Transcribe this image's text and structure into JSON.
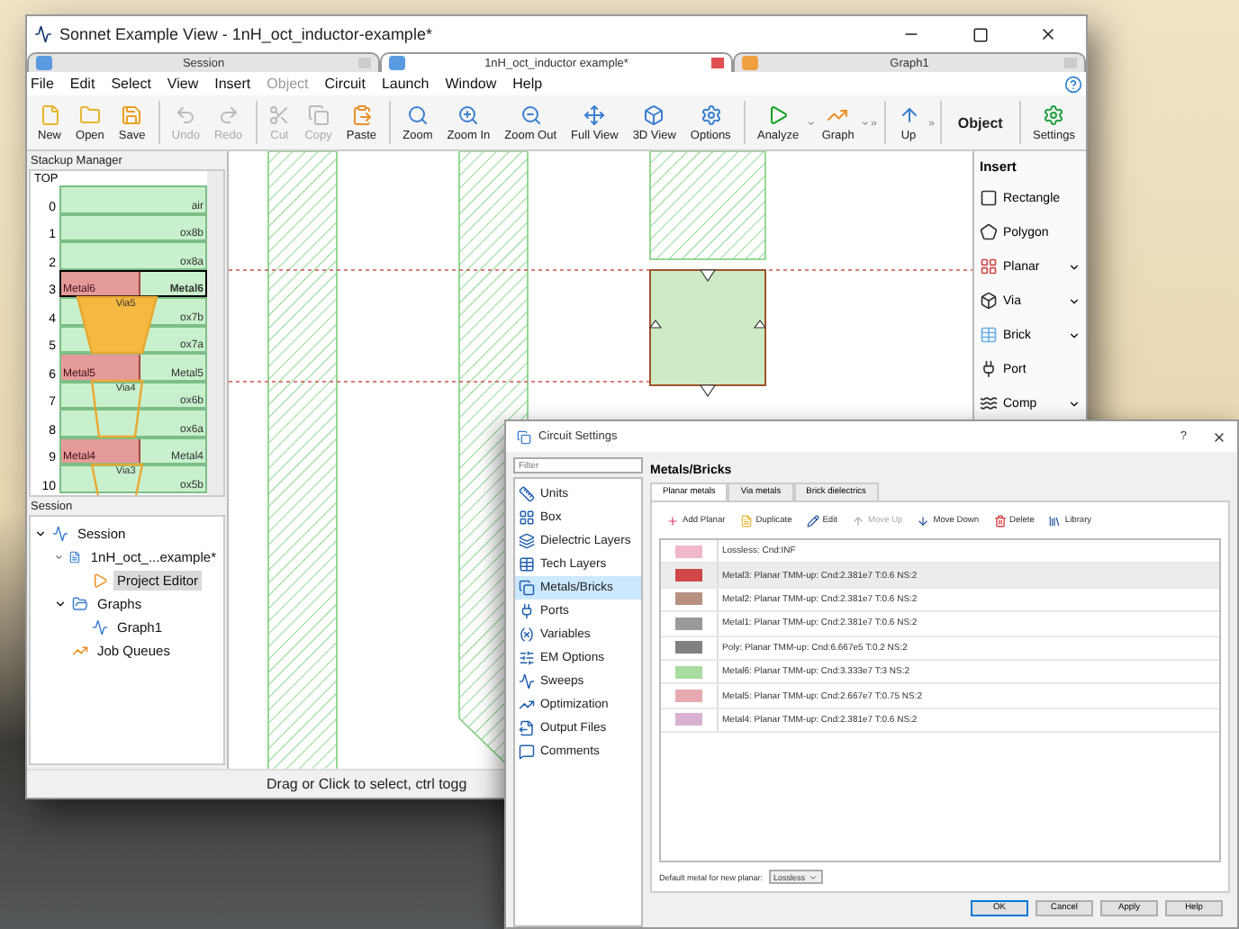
{
  "window": {
    "title": "Sonnet Example View - 1nH_oct_inductor-example*"
  },
  "tabs": [
    {
      "label": "Session",
      "selected": false
    },
    {
      "label": "1nH_oct_inductor example*",
      "selected": true
    },
    {
      "label": "Graph1",
      "selected": false
    }
  ],
  "menu": [
    {
      "label": "File",
      "disabled": false
    },
    {
      "label": "Edit",
      "disabled": false
    },
    {
      "label": "Select",
      "disabled": false
    },
    {
      "label": "View",
      "disabled": false
    },
    {
      "label": "Insert",
      "disabled": false
    },
    {
      "label": "Object",
      "disabled": true
    },
    {
      "label": "Circuit",
      "disabled": false
    },
    {
      "label": "Launch",
      "disabled": false
    },
    {
      "label": "Window",
      "disabled": false
    },
    {
      "label": "Help",
      "disabled": false
    }
  ],
  "toolbar": [
    {
      "kind": "button",
      "label": "New",
      "disabled": false
    },
    {
      "kind": "button",
      "label": "Open",
      "disabled": false
    },
    {
      "kind": "button",
      "label": "Save",
      "disabled": false
    },
    {
      "kind": "separator"
    },
    {
      "kind": "button",
      "label": "Undo",
      "disabled": true
    },
    {
      "kind": "button",
      "label": "Redo",
      "disabled": true
    },
    {
      "kind": "separator"
    },
    {
      "kind": "button",
      "label": "Cut",
      "disabled": true
    },
    {
      "kind": "button",
      "label": "Copy",
      "disabled": true
    },
    {
      "kind": "button",
      "label": "Paste",
      "disabled": false
    },
    {
      "kind": "separator"
    },
    {
      "kind": "button",
      "label": "Zoom",
      "disabled": false
    },
    {
      "kind": "button",
      "label": "Zoom In",
      "disabled": false
    },
    {
      "kind": "button",
      "label": "Zoom Out",
      "disabled": false
    },
    {
      "kind": "button",
      "label": "Full View",
      "disabled": false
    },
    {
      "kind": "button",
      "label": "3D View",
      "disabled": false
    },
    {
      "kind": "button",
      "label": "Options",
      "disabled": false
    },
    {
      "kind": "separator"
    },
    {
      "kind": "split",
      "label": "Analyze",
      "disabled": false
    },
    {
      "kind": "split",
      "label": "Graph",
      "disabled": false
    },
    {
      "kind": "overflow"
    },
    {
      "kind": "separator"
    },
    {
      "kind": "button",
      "label": "Up",
      "disabled": false
    },
    {
      "kind": "overflow"
    },
    {
      "kind": "separator"
    },
    {
      "kind": "text",
      "label": "Object",
      "disabled": false
    },
    {
      "kind": "separator"
    },
    {
      "kind": "button",
      "label": "Settings",
      "disabled": false
    }
  ],
  "stackup": {
    "title": "Stackup Manager",
    "top_label": "TOP",
    "rows": [
      {
        "index": "0",
        "layer": "air",
        "selected": false
      },
      {
        "index": "1",
        "layer": "ox8b",
        "selected": false
      },
      {
        "index": "2",
        "layer": "ox8a",
        "selected": false
      },
      {
        "index": "3",
        "layer": "Metal6",
        "metal": "Metal6",
        "selected": true
      },
      {
        "index": "4",
        "layer": "ox7b",
        "via": "Via5",
        "selected": false
      },
      {
        "index": "5",
        "layer": "ox7a",
        "selected": false
      },
      {
        "index": "6",
        "layer": "Metal5",
        "metal": "Metal5",
        "selected": false
      },
      {
        "index": "7",
        "layer": "ox6b",
        "via": "Via4",
        "selected": false
      },
      {
        "index": "8",
        "layer": "ox6a",
        "selected": false
      },
      {
        "index": "9",
        "layer": "Metal4",
        "metal": "Metal4",
        "selected": false
      },
      {
        "index": "10",
        "layer": "ox5b",
        "via": "Via3",
        "selected": false
      }
    ]
  },
  "session": {
    "title": "Session",
    "tree": [
      {
        "label": "Session",
        "expanded": true,
        "selected": false,
        "children": [
          {
            "label": "1nH_oct_...example*",
            "expanded": true,
            "selected": false,
            "children": [
              {
                "label": "Project Editor",
                "selected": true
              }
            ]
          },
          {
            "label": "Graphs",
            "expanded": true,
            "selected": false,
            "children": [
              {
                "label": "Graph1",
                "selected": false
              }
            ]
          },
          {
            "label": "Job Queues",
            "selected": false
          }
        ]
      }
    ]
  },
  "insert": {
    "title": "Insert",
    "items": [
      {
        "label": "Rectangle",
        "dropdown": false
      },
      {
        "label": "Polygon",
        "dropdown": false
      },
      {
        "label": "Planar",
        "dropdown": true
      },
      {
        "label": "Via",
        "dropdown": true
      },
      {
        "label": "Brick",
        "dropdown": true
      },
      {
        "label": "Port",
        "dropdown": false
      },
      {
        "label": "Comp",
        "dropdown": true
      }
    ]
  },
  "status_bar": "Drag or Click to select, ctrl togg",
  "dialog": {
    "title": "Circuit Settings",
    "help_glyph": "?",
    "filter": {
      "placeholder": "Filter"
    },
    "nav": [
      {
        "label": "Units",
        "selected": false
      },
      {
        "label": "Box",
        "selected": false
      },
      {
        "label": "Dielectric Layers",
        "selected": false
      },
      {
        "label": "Tech Layers",
        "selected": false
      },
      {
        "label": "Metals/Bricks",
        "selected": true
      },
      {
        "label": "Ports",
        "selected": false
      },
      {
        "label": "Variables",
        "selected": false
      },
      {
        "label": "EM Options",
        "selected": false
      },
      {
        "label": "Sweeps",
        "selected": false
      },
      {
        "label": "Optimization",
        "selected": false
      },
      {
        "label": "Output Files",
        "selected": false
      },
      {
        "label": "Comments",
        "selected": false
      }
    ],
    "heading": "Metals/Bricks",
    "tabs": [
      {
        "label": "Planar metals",
        "selected": true
      },
      {
        "label": "Via metals",
        "selected": false
      },
      {
        "label": "Brick dielectrics",
        "selected": false
      }
    ],
    "actions": [
      {
        "label": "Add Planar",
        "disabled": false
      },
      {
        "label": "Duplicate",
        "disabled": false
      },
      {
        "label": "Edit",
        "disabled": false
      },
      {
        "label": "Move Up",
        "disabled": true
      },
      {
        "label": "Move Down",
        "disabled": false
      },
      {
        "label": "Delete",
        "disabled": false
      },
      {
        "label": "Library",
        "disabled": false
      }
    ],
    "metals": [
      {
        "text": "Lossless: Cnd:INF",
        "color": "#f0b8c8",
        "selected": false
      },
      {
        "text": "Metal3:  Planar TMM-up: Cnd:2.381e7 T:0.6 NS:2",
        "color": "#d04848",
        "selected": true
      },
      {
        "text": "Metal2:  Planar TMM-up: Cnd:2.381e7 T:0.6 NS:2",
        "color": "#b89080",
        "selected": false
      },
      {
        "text": "Metal1:  Planar TMM-up: Cnd:2.381e7 T:0.6 NS:2",
        "color": "#9a9a9a",
        "selected": false
      },
      {
        "text": "Poly:  Planar TMM-up: Cnd:6.667e5 T:0.2 NS:2",
        "color": "#808080",
        "selected": false
      },
      {
        "text": "Metal6:  Planar TMM-up: Cnd:3.333e7 T:3 NS:2",
        "color": "#a8dca0",
        "selected": false
      },
      {
        "text": "Metal5:  Planar TMM-up: Cnd:2.667e7 T:0.75 NS:2",
        "color": "#e8a8b0",
        "selected": false
      },
      {
        "text": "Metal4:  Planar TMM-up: Cnd:2.381e7 T:0.6 NS:2",
        "color": "#d8b0d0",
        "selected": false
      }
    ],
    "default_label": "Default metal for  new planar:",
    "default_value": "Lossless",
    "buttons": [
      "OK",
      "Cancel",
      "Apply",
      "Help"
    ]
  }
}
